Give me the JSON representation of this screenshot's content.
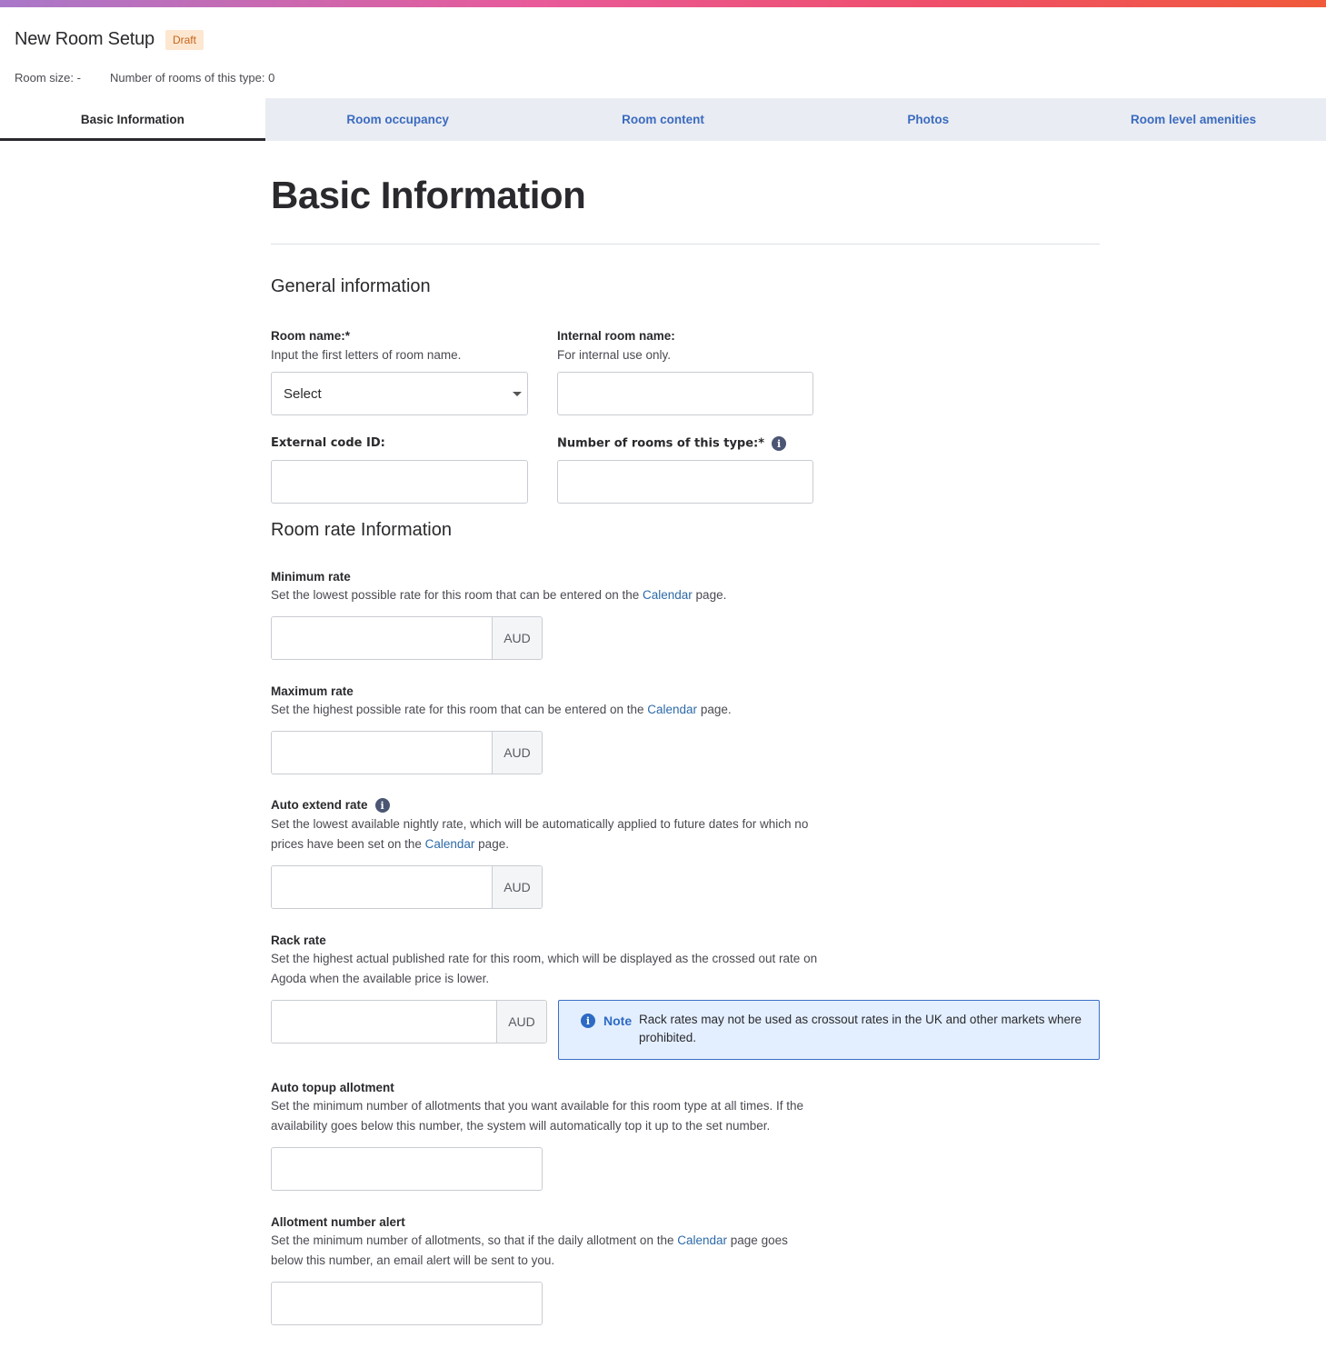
{
  "header": {
    "title": "New Room Setup",
    "status": "Draft",
    "room_size": "Room size: -",
    "rooms_count": "Number of rooms of this type: 0"
  },
  "tabs": [
    {
      "label": "Basic Information",
      "active": true
    },
    {
      "label": "Room occupancy",
      "active": false
    },
    {
      "label": "Room content",
      "active": false
    },
    {
      "label": "Photos",
      "active": false
    },
    {
      "label": "Room level amenities",
      "active": false
    }
  ],
  "main": {
    "heading": "Basic Information",
    "general": {
      "heading": "General information",
      "room_name": {
        "label": "Room name:*",
        "help": "Input the first letters of room name.",
        "value": "Select"
      },
      "internal_name": {
        "label": "Internal room name:",
        "help": "For internal use only.",
        "value": ""
      },
      "external_code": {
        "label": "External code ID:",
        "value": ""
      },
      "num_rooms": {
        "label": "Number of rooms of this type:*",
        "value": ""
      }
    },
    "rate": {
      "heading": "Room rate Information",
      "currency": "AUD",
      "link_text": "Calendar",
      "min_rate": {
        "label": "Minimum rate",
        "help_before": "Set the lowest possible rate for this room that can be entered on the ",
        "help_after": " page."
      },
      "max_rate": {
        "label": "Maximum rate",
        "help_before": "Set the highest possible rate for this room that can be entered on the ",
        "help_after": " page."
      },
      "auto_extend": {
        "label": "Auto extend rate",
        "help_before": "Set the lowest available nightly rate, which will be automatically applied to future dates for which no prices have been set on the ",
        "help_after": " page."
      },
      "rack_rate": {
        "label": "Rack rate",
        "help": "Set the highest actual published rate for this room, which will be displayed as the crossed out rate on Agoda when the available price is lower."
      },
      "note": {
        "title": "Note",
        "text": "Rack rates may not be used as crossout rates in the UK and other markets where prohibited."
      },
      "auto_topup": {
        "label": "Auto topup allotment",
        "help": "Set the minimum number of allotments that you want available for this room type at all times. If the availability goes below this number, the system will automatically top it up to the set number."
      },
      "allotment_alert": {
        "label": "Allotment number alert",
        "help_before": "Set the minimum number of allotments, so that if the daily allotment on the ",
        "help_after": " page goes below this number, an email alert will be sent to you."
      }
    }
  }
}
